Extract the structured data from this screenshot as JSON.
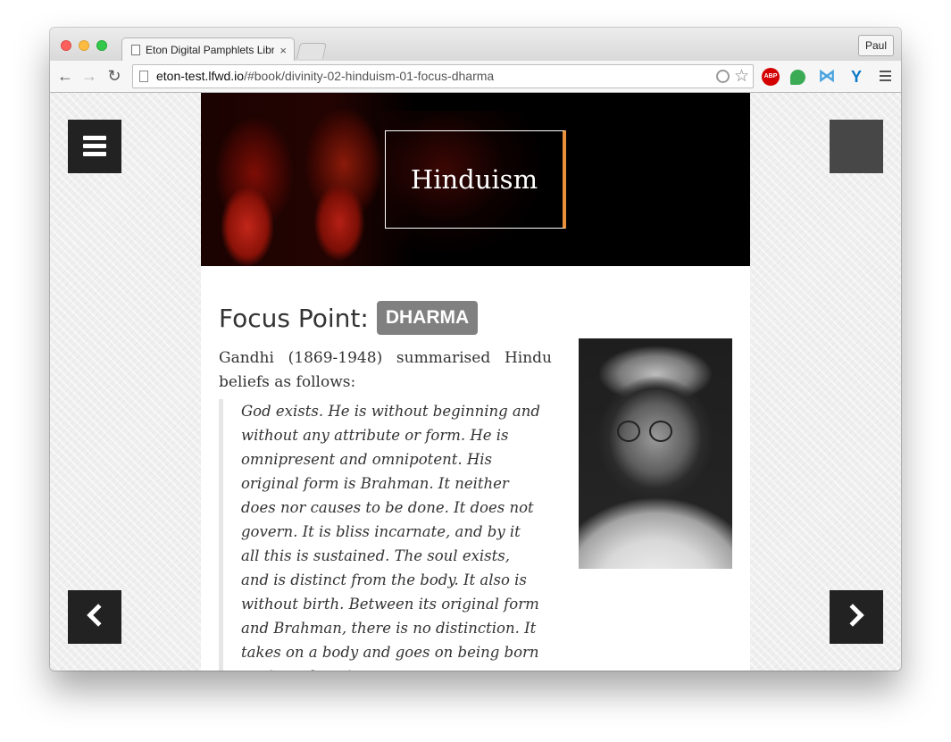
{
  "browser": {
    "tab_title": "Eton Digital Pamphlets Libr",
    "tab_close": "×",
    "profile_name": "Paul",
    "url_host": "eton-test.lfwd.io",
    "url_path": "/#book/divinity-02-hinduism-01-focus-dharma",
    "back_glyph": "←",
    "forward_glyph": "→",
    "reload_glyph": "↻",
    "star_glyph": "☆",
    "ext_abp_label": "ABP",
    "ext_mixpanel_glyph": "⋈",
    "ext_vision_glyph": "Y"
  },
  "banner": {
    "title": "Hinduism",
    "accent_color": "#e8913a"
  },
  "page": {
    "heading_label": "Focus Point:",
    "heading_tag": "DHARMA",
    "intro": "Gandhi (1869-1948) summarised Hindu beliefs as follows:",
    "quote": "God exists. He is without beginning and without any attribute or form. He is omnipresent and omnipotent. His original form is Brahman. It neither does nor causes to be done. It does not govern. It is bliss incarnate, and by it all this is sustained. The soul exists, and is distinct from the body. It also is without birth. Between its original form and Brahman, there is no distinction. It takes on a body and goes on being born again and again"
  },
  "icons": {
    "menu": "hamburger-icon",
    "prev": "chevron-left-icon",
    "next": "chevron-right-icon"
  }
}
